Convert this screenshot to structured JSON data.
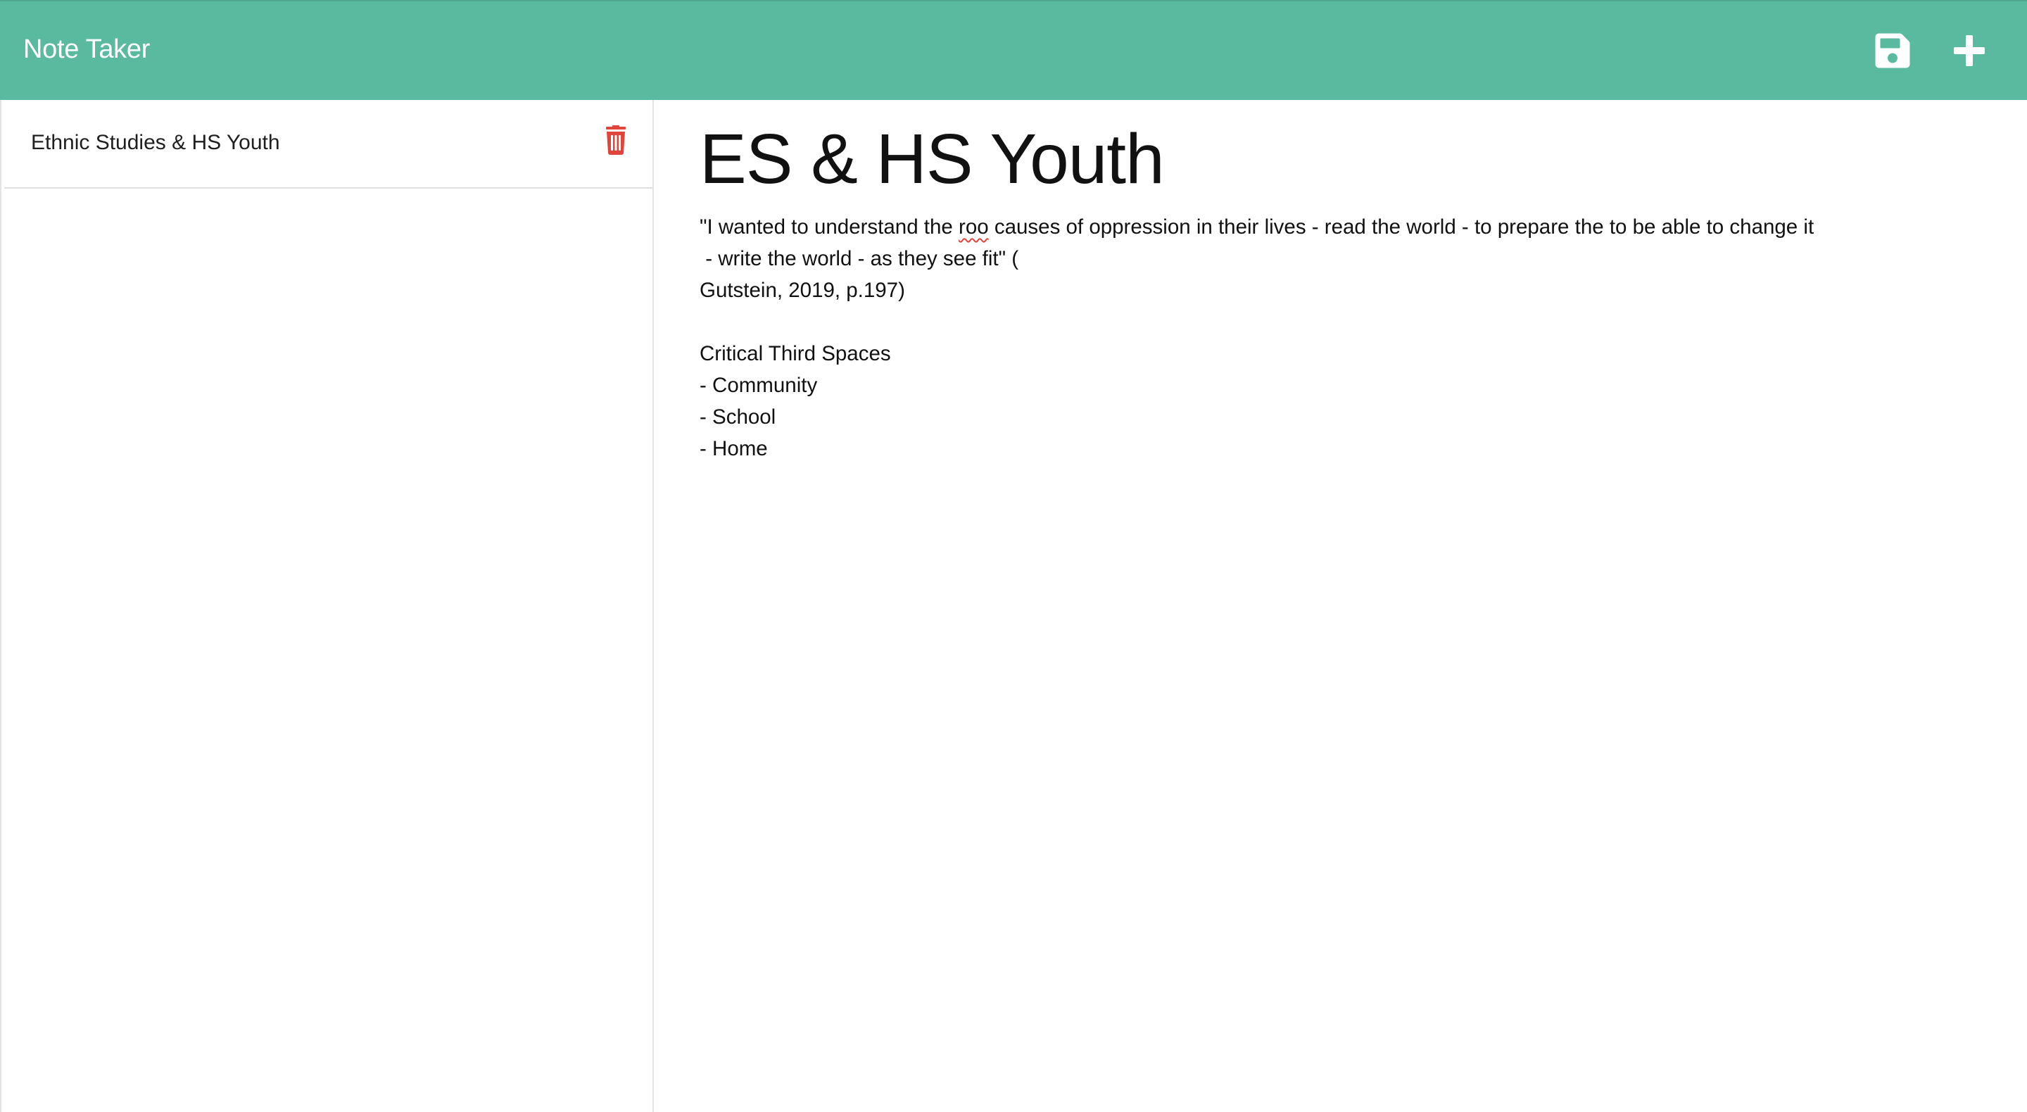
{
  "app": {
    "title": "Note Taker",
    "accent_color": "#5aba9f",
    "delete_color": "#e0443b"
  },
  "toolbar": {
    "save_icon": "floppy-disk-icon",
    "add_icon": "plus-icon"
  },
  "sidebar": {
    "notes": [
      {
        "title": "Ethnic Studies & HS Youth",
        "action_icon": "trash-icon"
      }
    ]
  },
  "editor": {
    "title": "ES & HS Youth",
    "text": {
      "line1_before": "\"I wanted to understand the ",
      "line1_misspelled": "roo",
      "line1_after": " causes of oppression in their lives - read the world - to prepare the to be able to change it",
      "rest": "\n - write the world - as they see fit\" (\nGutstein, 2019, p.197)\n\nCritical Third Spaces\n- Community\n- School\n- Home"
    }
  }
}
